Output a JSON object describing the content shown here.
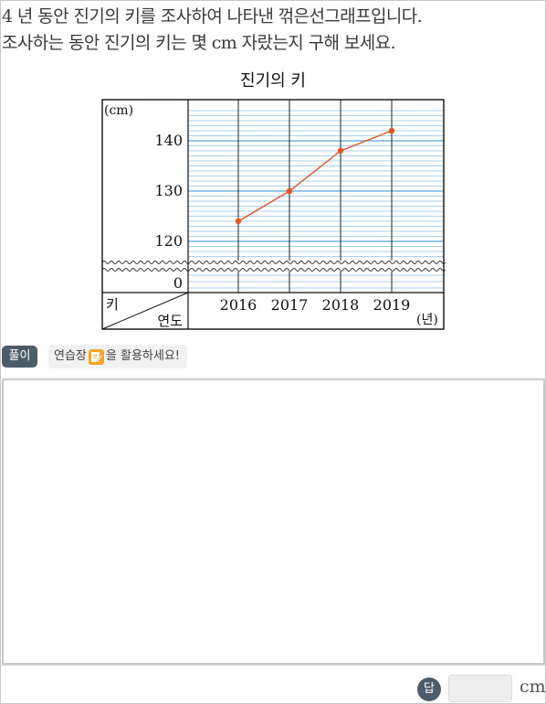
{
  "question": {
    "line1": "4 년 동안 진기의 키를 조사하여 나타낸 꺾은선그래프입니다.",
    "line2": "조사하는 동안 진기의 키는 몇 cm 자랐는지 구해 보세요."
  },
  "chart_data": {
    "type": "line",
    "title": "진기의 키",
    "y_unit_label": "(cm)",
    "x_unit_label": "(년)",
    "corner_row_label": "키",
    "corner_col_label": "연도",
    "categories": [
      "2016",
      "2017",
      "2018",
      "2019"
    ],
    "values": [
      124,
      130,
      138,
      142
    ],
    "ylim": [
      115,
      146
    ],
    "yticks": [
      120,
      130,
      140
    ],
    "zero_label": "0",
    "axis_break": true,
    "minor_grid_step": 1,
    "grid": true,
    "line_color": "#e8531f",
    "grid_color": "#8fc3e6",
    "major_grid_color": "#5aa3d6"
  },
  "solution": {
    "badge": "풀이",
    "tip_before": "연습장",
    "tip_icon": "memo-pencil-icon",
    "tip_after": "을 활용하세요!"
  },
  "answer": {
    "badge": "답",
    "value": "",
    "unit": "cm"
  }
}
